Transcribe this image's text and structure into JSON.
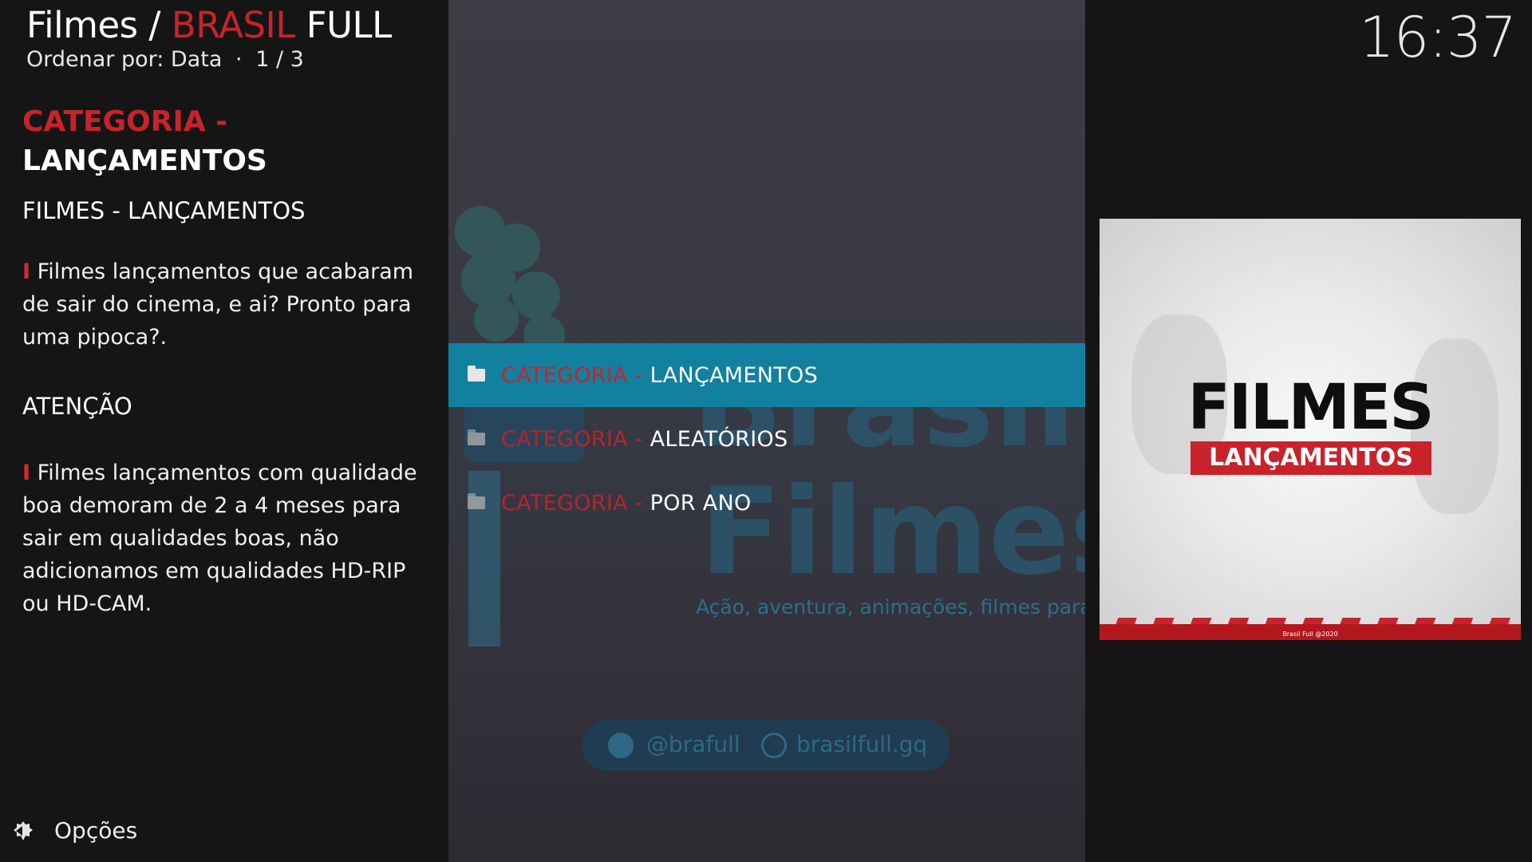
{
  "header": {
    "section": "Filmes",
    "separator": "/",
    "addon_red": "BRASIL",
    "addon_white": "FULL",
    "sort_label": "Ordenar por: Data",
    "dot": "·",
    "page": "1 / 3"
  },
  "clock": "16:37",
  "info": {
    "title_red": "CATEGORIA -",
    "title_white": "LANÇAMENTOS",
    "subtitle": "FILMES - LANÇAMENTOS",
    "bar": "I",
    "para1": "Filmes lançamentos que acabaram de sair do cinema, e ai? Pronto para uma pipoca?.",
    "attention": "ATENÇÃO",
    "para2": "Filmes lançamentos com qualidade boa demoram de 2 a 4 meses para sair em qualidades boas, não adicionamos em qualidades HD-RIP ou HD-CAM."
  },
  "fanart": {
    "big1": "Brasil",
    "big2": "Filmes",
    "slogan": "Ação, aventura, animações, filmes para",
    "facebook": "@brafull",
    "website": "brasilfull.gq"
  },
  "list": {
    "parent": "..",
    "items": [
      {
        "prefix": "CATEGORIA - ",
        "name": "LANÇAMENTOS",
        "selected": true
      },
      {
        "prefix": "CATEGORIA - ",
        "name": "ALEATÓRIOS",
        "selected": false
      },
      {
        "prefix": "CATEGORIA - ",
        "name": "POR ANO",
        "selected": false
      }
    ]
  },
  "poster": {
    "title1": "FILMES",
    "title2": "LANÇAMENTOS",
    "copyright": "Brasil Full @2020"
  },
  "options_label": "Opções",
  "colors": {
    "accent_red": "#c8232b",
    "selection_blue": "#12809f",
    "background": "#151515"
  }
}
